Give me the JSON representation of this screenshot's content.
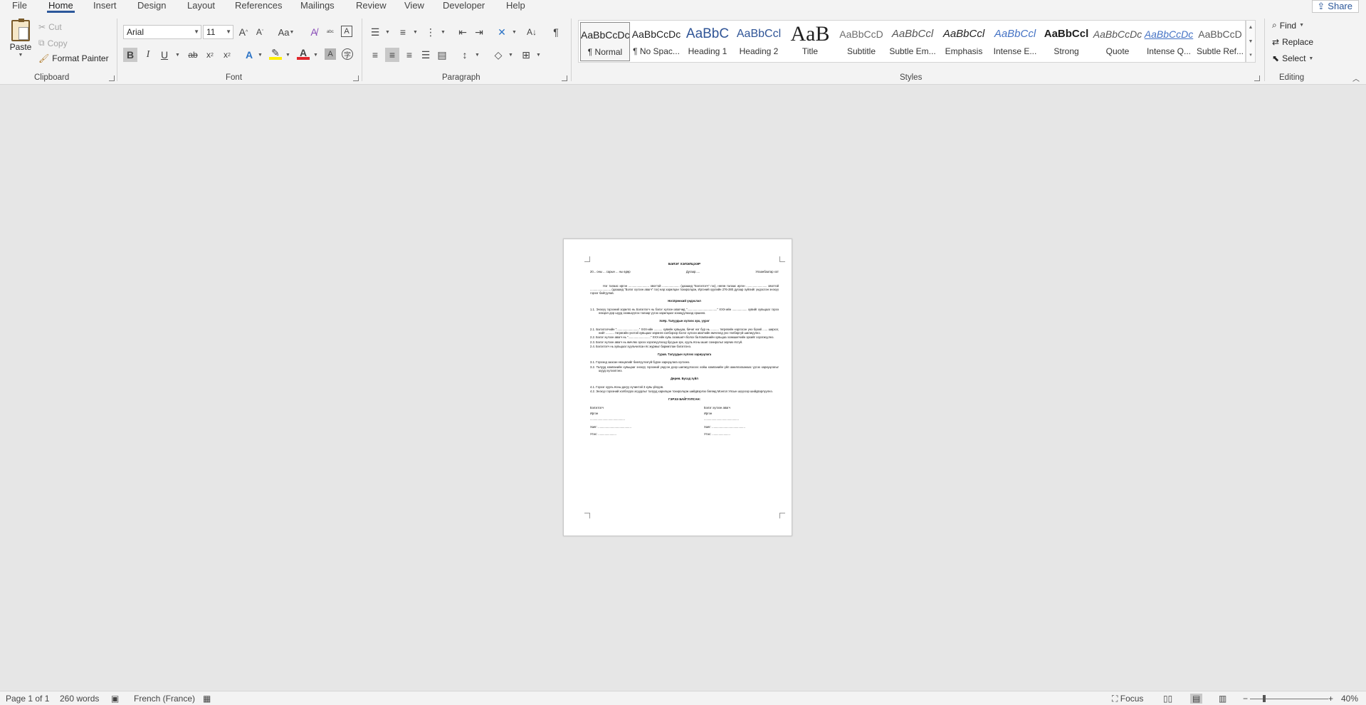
{
  "menu": {
    "tabs": [
      "File",
      "Home",
      "Insert",
      "Design",
      "Layout",
      "References",
      "Mailings",
      "Review",
      "View",
      "Developer",
      "Help"
    ],
    "share": "Share",
    "accent": "#2b579a"
  },
  "clipboard": {
    "paste": "Paste",
    "cut": "Cut",
    "copy": "Copy",
    "format_painter": "Format Painter",
    "label": "Clipboard"
  },
  "font": {
    "family": "Arial",
    "size": "11",
    "label": "Font",
    "case_label": "Aa"
  },
  "paragraph": {
    "label": "Paragraph"
  },
  "styles": {
    "label": "Styles",
    "items": [
      {
        "preview": "AaBbCcDc",
        "name": "¶ Normal"
      },
      {
        "preview": "AaBbCcDc",
        "name": "¶ No Spac..."
      },
      {
        "preview": "AaBbC",
        "name": "Heading 1"
      },
      {
        "preview": "AaBbCcl",
        "name": "Heading 2"
      },
      {
        "preview": "AaB",
        "name": "Title"
      },
      {
        "preview": "AaBbCcD",
        "name": "Subtitle"
      },
      {
        "preview": "AaBbCcl",
        "name": "Subtle Em..."
      },
      {
        "preview": "AaBbCcl",
        "name": "Emphasis"
      },
      {
        "preview": "AaBbCcl",
        "name": "Intense E..."
      },
      {
        "preview": "AaBbCcl",
        "name": "Strong"
      },
      {
        "preview": "AaBbCcDc",
        "name": "Quote"
      },
      {
        "preview": "AaBbCcDc",
        "name": "Intense Q..."
      },
      {
        "preview": "AaBbCcD",
        "name": "Subtle Ref..."
      }
    ]
  },
  "editing": {
    "label": "Editing",
    "find": "Find",
    "replace": "Replace",
    "select": "Select"
  },
  "document": {
    "title": "БЭЛЭГ ХЭЛЭЛЦЭЭР",
    "date_line": "20... оны ... сарын ... ны өдөр",
    "number_line": "Дугаар.....",
    "city": "Улаанбаатар хот",
    "intro": "Нэг талаас иргэн ......................... овогтой ..................... (цаашид \"Бэлэглэгч\" гэх), нөгөө талаас иргэн ......................... овогтой ......................... (цаашид \"Бэлэг хүлээн авагч\" гэх) нар харилцан тохиролцож, Иргэний хуулийн 276-280 дугаар зүйлийг үндэслэн энэхүү гэрээг байгуулав.",
    "s1": "Нэг.Ерөнхий үндэслэл",
    "s1_1": "1.1. Энэхүү гэрээний зорилго нь Бэлэглэгч нь бэлэг хүлээн авагчид \"....................................\" XXX-ийн .................. хувийг хувьцааг гэрээ нөхцөл дор шууд эзэмшүүлэх талаар үүсэх харилцааг зохицуулахад оршино.",
    "s2": "Хоёр. Талуудын хүлээх эрх, үүрэг",
    "s2_1": "2.1. Бэлэглэгчийн \"...........................\" XXX-ийн .......... хувийн хувьцаа, бичиг нэг бүр нь .......... төгрөгийн нэрлэсэн үнэ бүхий ...... ширхэг, нийт .......... төгрөгийн үнэтэй хувьцааг хөрөнгө хэлбэрээр бэлэг хүлээн авагчийн өмчлөлд үнэ төлбөргүй шилжүүлнэ.",
    "s2_2": "2.2. Бэлэг хүлээн авагч нь \"...........................\" XXX-ийн хувь эзэмшигч болох ба Компанийн хувьцаа эзэмшигчийн эрхийг хэрэгжүүлнэ.",
    "s2_3": "2.3. Бэлэг хүлээн авагч нь өмчлөх эрхээ хэрэгжүүлэхэд бусдын эрх, хууль ёсны ашиг сонирхлыг зөрчих ёсгүй.",
    "s2_4": "2.4. Бэлэглэгч нь хувьцааг хуульчилсан ёс журмыг баримтлан бэлэглэнэ.",
    "s3": "Гурав. Талуудын хүлээх хариуцлага",
    "s3_1": "3.1. Гэрээнд заасан нөхцөлийг биелүүлээгүй бүрэн хариуцлага хүлээнэ.",
    "s3_2": "3.2. Талууд компанийн хувьцааг энэхүү гэрээний үндсэн дээр шилжүүлэхээс хойш компанийн үйл ажиллагаанаас үүсэх хариуцлагыг шууд хүлээлгэнэ.",
    "s4": "Дөрөв. Бусад зүйл",
    "s4_1": "4.1. Гэрээг хууль ёсны дагуу хүчинтэй 3 хувь үйлдэв.",
    "s4_2": "4.2. Энэхүү гэрээний холбогдох асуудлыг талууд харилцан тохиролцож шийдвэрлэх бөгөөд Монгол Улсын шүүхээр шийдвэрлүүлнэ.",
    "sign_title": "ГЭРЭЭ БАЙГУУЛСАН:",
    "left": {
      "role": "Бэлэглэгч",
      "citizen": "Иргэн",
      "line": "..........................................",
      "address": "Хаяг: ........................................",
      "phone": "Утас: ......................"
    },
    "right": {
      "role": "Бэлэг хүлээн авагч",
      "citizen": "Иргэн",
      "line": "..........................................",
      "address": "Хаяг: ........................................",
      "phone": "Утас: ......................"
    }
  },
  "status": {
    "page": "Page 1 of 1",
    "words": "260 words",
    "language": "French (France)",
    "focus": "Focus",
    "zoom": "40%"
  }
}
